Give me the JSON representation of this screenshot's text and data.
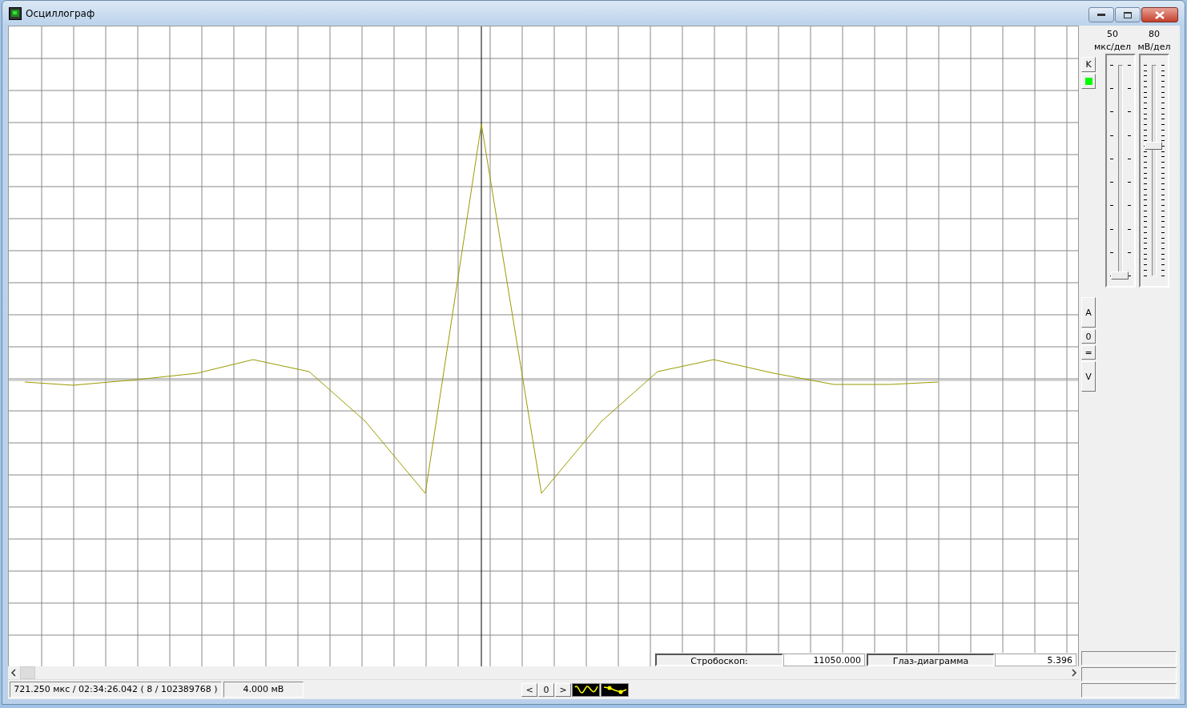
{
  "window": {
    "title": "Осциллограф"
  },
  "scales": [
    {
      "value": "50",
      "unit": "мкс/дел",
      "kind": "coarse",
      "level": 0
    },
    {
      "value": "80",
      "unit": "мВ/дел",
      "kind": "fine",
      "level": 0.62
    }
  ],
  "top_button": "K",
  "indicator": {
    "on": true
  },
  "side_buttons": [
    {
      "label": "A",
      "kind": "tall"
    },
    {
      "label": "0",
      "kind": "short"
    },
    {
      "label": "=",
      "kind": "short"
    },
    {
      "label": "V",
      "kind": "tall"
    }
  ],
  "strobe": {
    "label": "Стробоскоп:",
    "value": "11050.000",
    "mode": "Глаз-диаграмма",
    "mode_value": "5.396"
  },
  "status": {
    "position": "721.250 мкс / 02:34:26.042 ( 8 / 102389768 )",
    "amplitude": "4.000 мВ"
  },
  "nav": {
    "prev": "<",
    "counter": "0",
    "next": ">"
  },
  "display_modes": [
    {
      "kind": "wave"
    },
    {
      "kind": "points"
    }
  ]
}
